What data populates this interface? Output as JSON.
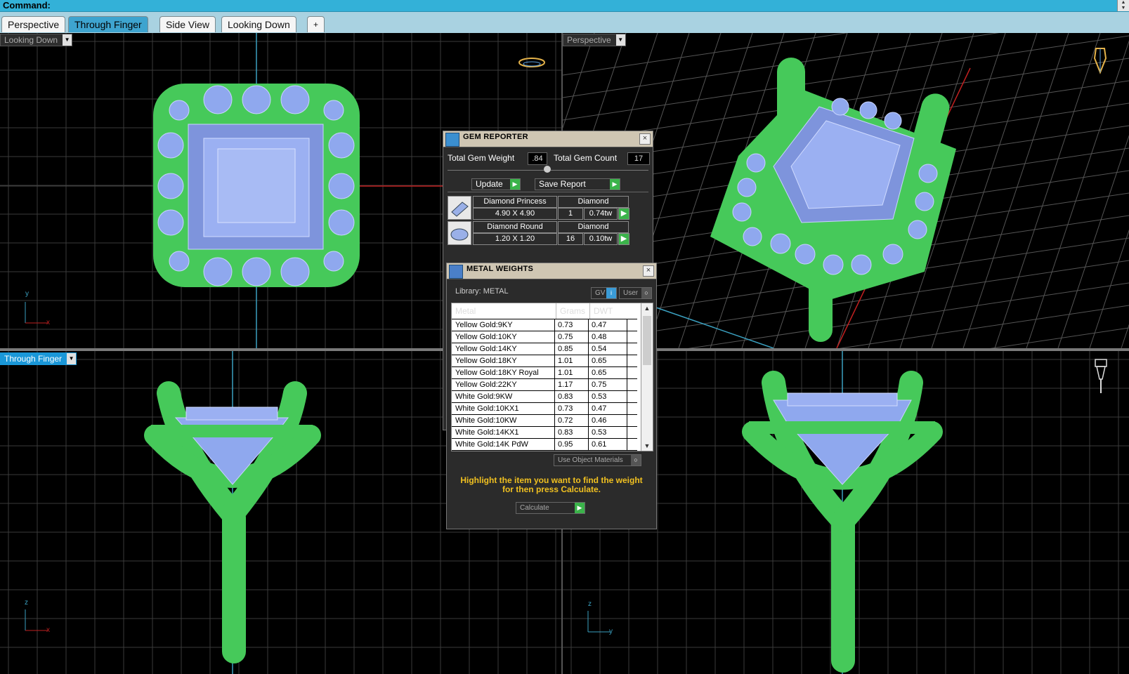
{
  "command": {
    "label": "Command:"
  },
  "tabs": [
    {
      "label": "Perspective",
      "active": false
    },
    {
      "label": "Through Finger",
      "active": true
    },
    {
      "label": "Side View",
      "active": false
    },
    {
      "label": "Looking Down",
      "active": false
    },
    {
      "label": "+",
      "active": false
    }
  ],
  "viewports": {
    "top_left": {
      "label": "Looking Down",
      "axis_v": "y",
      "axis_h": "x"
    },
    "top_right": {
      "label": "Perspective"
    },
    "bottom_left": {
      "label": "Through Finger",
      "axis_v": "z",
      "axis_h": "x"
    },
    "bottom_right": {
      "axis_v": "z",
      "axis_h": "y"
    }
  },
  "colors": {
    "metal": "#46c95a",
    "gem": "#8fa8ee",
    "grid": "#3a3a3a",
    "accent": "#1a97d8"
  },
  "gem_reporter": {
    "title": "GEM REPORTER",
    "total_weight_label": "Total Gem Weight",
    "total_weight_value": ".84",
    "total_count_label": "Total Gem Count",
    "total_count_value": "17",
    "update_label": "Update",
    "save_report_label": "Save Report",
    "gems": [
      {
        "name": "Diamond Princess",
        "material": "Diamond",
        "size": "4.90 X 4.90",
        "count": "1",
        "weight": "0.74tw",
        "shape": "princess"
      },
      {
        "name": "Diamond Round",
        "material": "Diamond",
        "size": "1.20 X 1.20",
        "count": "16",
        "weight": "0.10tw",
        "shape": "round"
      }
    ]
  },
  "metal_weights": {
    "title": "METAL WEIGHTS",
    "library_label": "Library: METAL",
    "gv_label": "GV",
    "user_label": "User",
    "columns": [
      "Metal",
      "Grams",
      "DWT"
    ],
    "rows": [
      {
        "metal": "Yellow Gold:9KY",
        "grams": "0.73",
        "dwt": "0.47"
      },
      {
        "metal": "Yellow Gold:10KY",
        "grams": "0.75",
        "dwt": "0.48"
      },
      {
        "metal": "Yellow Gold:14KY",
        "grams": "0.85",
        "dwt": "0.54"
      },
      {
        "metal": "Yellow Gold:18KY",
        "grams": "1.01",
        "dwt": "0.65"
      },
      {
        "metal": "Yellow Gold:18KY Royal",
        "grams": "1.01",
        "dwt": "0.65"
      },
      {
        "metal": "Yellow Gold:22KY",
        "grams": "1.17",
        "dwt": "0.75"
      },
      {
        "metal": "White Gold:9KW",
        "grams": "0.83",
        "dwt": "0.53"
      },
      {
        "metal": "White Gold:10KX1",
        "grams": "0.73",
        "dwt": "0.47"
      },
      {
        "metal": "White Gold:10KW",
        "grams": "0.72",
        "dwt": "0.46"
      },
      {
        "metal": "White Gold:14KX1",
        "grams": "0.83",
        "dwt": "0.53"
      },
      {
        "metal": "White Gold:14K PdW",
        "grams": "0.95",
        "dwt": "0.61"
      }
    ],
    "use_object_materials_label": "Use Object Materials",
    "note": "Highlight the item you want to find the weight for then press Calculate.",
    "calculate_label": "Calculate"
  }
}
